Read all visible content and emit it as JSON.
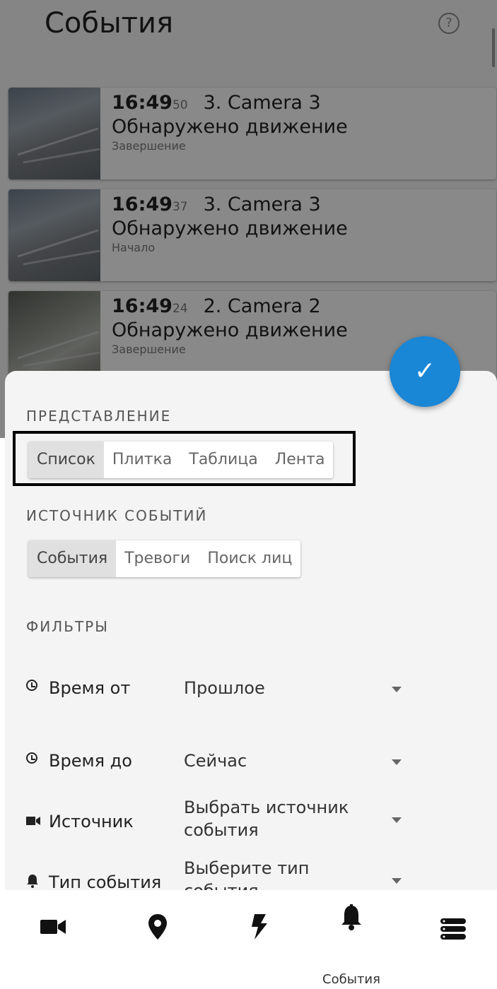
{
  "app": {
    "title": "События"
  },
  "events": [
    {
      "hhmm": "16:49",
      "sec": "50",
      "camera": "3. Camera 3",
      "type": "Обнаружено движение",
      "stage": "Завершение"
    },
    {
      "hhmm": "16:49",
      "sec": "37",
      "camera": "3. Camera 3",
      "type": "Обнаружено движение",
      "stage": "Начало"
    },
    {
      "hhmm": "16:49",
      "sec": "24",
      "camera": "2. Camera 2",
      "type": "Обнаружено движение",
      "stage": "Завершение"
    }
  ],
  "sheet": {
    "view_label": "ПРЕДСТАВЛЕНИЕ",
    "view_options": [
      "Список",
      "Плитка",
      "Таблица",
      "Лента"
    ],
    "view_selected": "Список",
    "source_label": "ИСТОЧНИК СОБЫТИЙ",
    "source_options": [
      "События",
      "Тревоги",
      "Поиск лиц"
    ],
    "source_selected": "События",
    "filters_label": "ФИЛЬТРЫ",
    "filters": [
      {
        "label": "Время от",
        "value": "Прошлое",
        "icon": "clock-icon"
      },
      {
        "label": "Время до",
        "value": "Сейчас",
        "icon": "clock-icon"
      },
      {
        "label": "Источник",
        "value": "Выбрать источник события",
        "icon": "video-camera-icon"
      },
      {
        "label": "Тип события",
        "value": "Выберите тип события",
        "icon": "bell-icon"
      }
    ]
  },
  "nav": {
    "items": [
      {
        "icon": "video-camera-icon",
        "label": ""
      },
      {
        "icon": "map-pin-icon",
        "label": ""
      },
      {
        "icon": "lightning-icon",
        "label": ""
      },
      {
        "icon": "bell-icon",
        "label": "События"
      },
      {
        "icon": "menu-stack-icon",
        "label": ""
      }
    ]
  },
  "colors": {
    "accent": "#1a86d6",
    "sheet_bg": "#f4f4f4",
    "segment_active": "#e0e0e0"
  }
}
